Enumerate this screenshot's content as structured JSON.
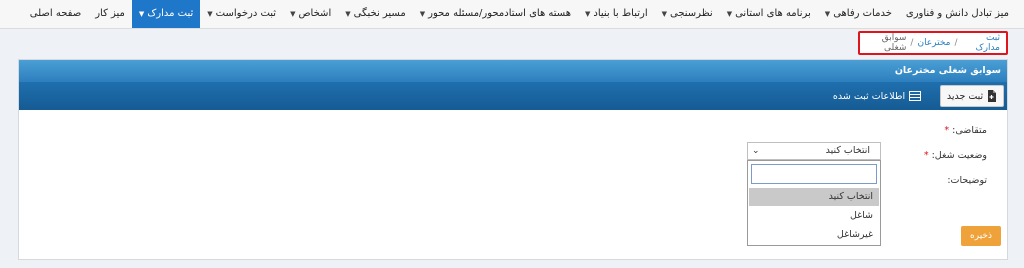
{
  "nav": {
    "items": [
      {
        "label": "صفحه اصلی",
        "caret": false
      },
      {
        "label": "میز کار",
        "caret": false
      },
      {
        "label": "ثبت مدارک",
        "caret": true,
        "active": true
      },
      {
        "label": "ثبت درخواست",
        "caret": true
      },
      {
        "label": "اشخاص",
        "caret": true
      },
      {
        "label": "مسیر نخبگی",
        "caret": true
      },
      {
        "label": "هسته های استادمحور/مسئله محور",
        "caret": true
      },
      {
        "label": "ارتباط با بنیاد",
        "caret": true
      },
      {
        "label": "نظرسنجی",
        "caret": true
      },
      {
        "label": "برنامه های استانی",
        "caret": true
      },
      {
        "label": "خدمات رفاهی",
        "caret": true
      },
      {
        "label": "میز تبادل دانش و فناوری",
        "caret": false
      }
    ],
    "active_color": "#1f77c9"
  },
  "breadcrumb": {
    "items": [
      "ثبت مدارک",
      "مخترعان",
      "سوابق شغلی"
    ],
    "separator": "/",
    "highlight_color": "#e0141c"
  },
  "panel": {
    "title": "سوابق شغلی مخترعان",
    "toolbar": {
      "new_label": "ثبت جدید",
      "info_label": "اطلاعات ثبت شده"
    }
  },
  "form": {
    "applicant_label": "متقاضی:",
    "job_status_label": "وضعیت شغل:",
    "description_label": "توضیحات:",
    "required_mark": "*",
    "job_status_select": {
      "value": "انتخاب کنید",
      "search_value": "",
      "options": [
        "انتخاب کنید",
        "شاغل",
        "غیرشاغل"
      ],
      "highlighted_option": "انتخاب کنید"
    },
    "save_label": "ذخیره"
  }
}
